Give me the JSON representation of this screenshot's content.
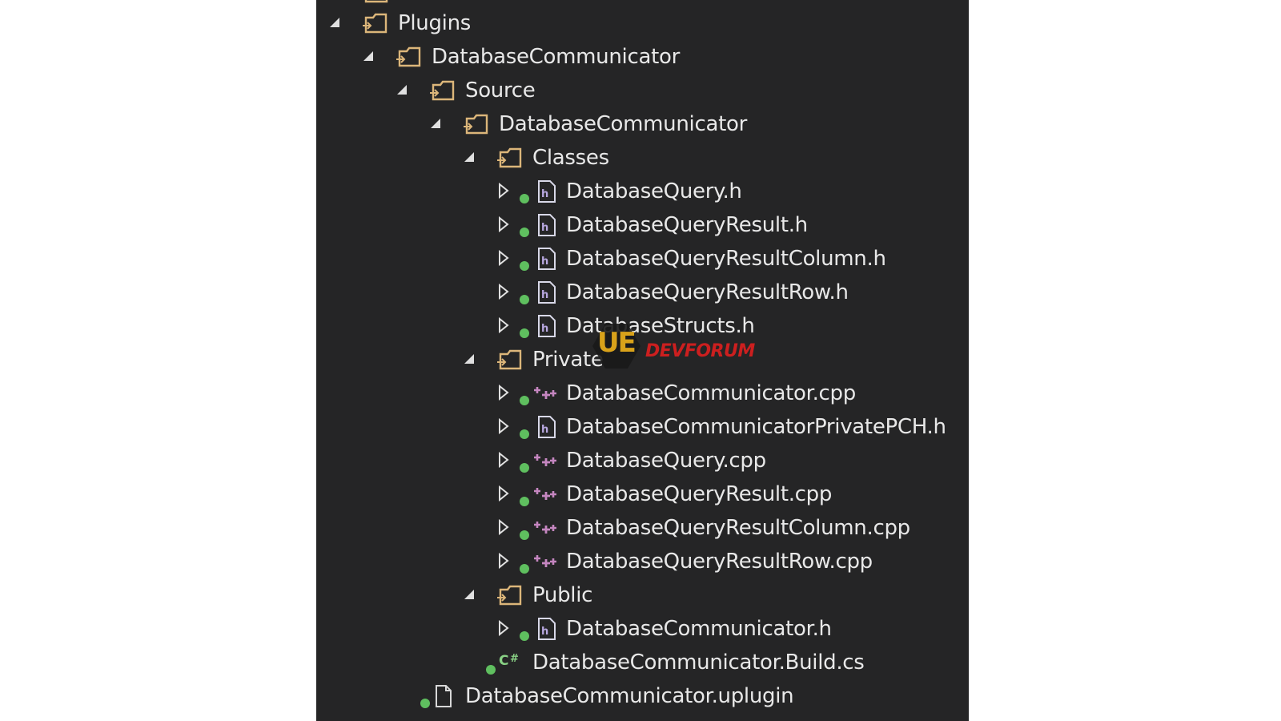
{
  "tree": {
    "plugins": {
      "label": "Plugins",
      "expander": "expanded"
    },
    "db_comm_root": {
      "label": "DatabaseCommunicator",
      "expander": "expanded"
    },
    "source": {
      "label": "Source",
      "expander": "expanded"
    },
    "db_comm_module": {
      "label": "DatabaseCommunicator",
      "expander": "expanded"
    },
    "classes": {
      "label": "Classes",
      "expander": "expanded",
      "files": [
        {
          "label": "DatabaseQuery.h",
          "icon": "header-file-icon"
        },
        {
          "label": "DatabaseQueryResult.h",
          "icon": "header-file-icon"
        },
        {
          "label": "DatabaseQueryResultColumn.h",
          "icon": "header-file-icon"
        },
        {
          "label": "DatabaseQueryResultRow.h",
          "icon": "header-file-icon"
        },
        {
          "label": "DatabaseStructs.h",
          "icon": "header-file-icon"
        }
      ]
    },
    "private": {
      "label": "Private",
      "expander": "expanded",
      "files": [
        {
          "label": "DatabaseCommunicator.cpp",
          "icon": "cpp-file-icon"
        },
        {
          "label": "DatabaseCommunicatorPrivatePCH.h",
          "icon": "header-file-icon"
        },
        {
          "label": "DatabaseQuery.cpp",
          "icon": "cpp-file-icon"
        },
        {
          "label": "DatabaseQueryResult.cpp",
          "icon": "cpp-file-icon"
        },
        {
          "label": "DatabaseQueryResultColumn.cpp",
          "icon": "cpp-file-icon"
        },
        {
          "label": "DatabaseQueryResultRow.cpp",
          "icon": "cpp-file-icon"
        }
      ]
    },
    "public": {
      "label": "Public",
      "expander": "expanded",
      "files": [
        {
          "label": "DatabaseCommunicator.h",
          "icon": "header-file-icon"
        }
      ]
    },
    "build_cs": {
      "label": "DatabaseCommunicator.Build.cs",
      "icon": "csharp-file-icon"
    },
    "uplugin": {
      "label": "DatabaseCommunicator.uplugin",
      "icon": "generic-file-icon"
    }
  },
  "watermark": {
    "logo_text": "UE",
    "brand_text": "DEVFORUM"
  },
  "colors": {
    "panel_background": "#252526",
    "text": "#e8e8e8",
    "folder_icon": "#dcb67a",
    "source_control_dot": "#5fbf5f",
    "cpp_icon": "#c586c0",
    "csharp_icon": "#89d185",
    "expander_glyph": "#e0e0e0"
  }
}
